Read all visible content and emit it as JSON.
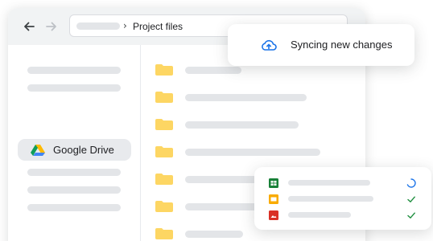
{
  "address_bar": {
    "separator": "›",
    "path": "Project files"
  },
  "sidebar": {
    "active_item": {
      "label": "Google Drive",
      "icon": "google-drive-icon"
    }
  },
  "sync_notification": {
    "label": "Syncing new changes",
    "icon": "cloud-sync-icon",
    "icon_color": "#1a73e8"
  },
  "uploads": [
    {
      "file_type": "sheets",
      "icon_color": "#188038",
      "status": "syncing"
    },
    {
      "file_type": "slides",
      "icon_color": "#f9ab00",
      "status": "done"
    },
    {
      "file_type": "image",
      "icon_color": "#d93025",
      "status": "done"
    }
  ],
  "colors": {
    "folder": "#fdd663",
    "placeholder": "#e3e5e8",
    "accent_blue": "#1a73e8",
    "done_green": "#1e8e3e"
  }
}
